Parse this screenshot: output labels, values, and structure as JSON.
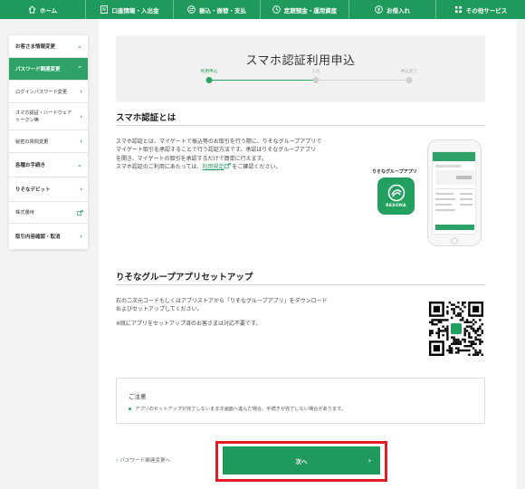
{
  "nav": {
    "items": [
      {
        "icon": "home-icon",
        "label": "ホーム"
      },
      {
        "icon": "bankbook-icon",
        "label": "口座情報・入出金"
      },
      {
        "icon": "transfer-icon",
        "label": "振込・振替・支払"
      },
      {
        "icon": "savings-icon",
        "label": "定期預金・運用資産"
      },
      {
        "icon": "loan-icon",
        "label": "お借入れ"
      },
      {
        "icon": "grid-icon",
        "label": "その他サービス"
      }
    ]
  },
  "sidebar": {
    "items": [
      {
        "label": "お客さま情報変更",
        "chev": "⌄"
      },
      {
        "label": "パスワード関連変更",
        "chev": "⌃"
      },
      {
        "label": "ログインパスワード変更",
        "chev": "›"
      },
      {
        "label": "スマホ認証・ハードウェアトークン等",
        "chev": "›"
      },
      {
        "label": "秘密の質問変更",
        "chev": "›"
      },
      {
        "label": "各種お手続き",
        "chev": "⌄"
      },
      {
        "label": "りそなデビット",
        "chev": "›"
      },
      {
        "label": "株式優待"
      },
      {
        "label": "取引内容確認・取消",
        "chev": "›"
      }
    ]
  },
  "main": {
    "title": "スマホ認証利用申込",
    "steps": [
      {
        "label": "利用申込"
      },
      {
        "label": "入力"
      },
      {
        "label": "申込完了"
      }
    ]
  },
  "section1": {
    "title": "スマホ認証とは",
    "lines": [
      "スマホ認証とは、マイゲートで振込等のお取引を行う際に、りそなグループアプリで",
      "マイゲート取引を承認することで行う認証方法です。承認はりそなグループアプリ",
      "を開き、マイゲートの取引を承認するだけで簡単に行えます。"
    ],
    "line4_pre": "スマホ認証のご利用にあたっては、",
    "line4_link": "利用規定",
    "line4_post": "をご確認ください。",
    "app_label": "りそなグループアプリ",
    "app_icon_text": "RESONA"
  },
  "section2": {
    "title": "りそなグループアプリセットアップ",
    "line1": "右の二次元コードもしくはアプリストアから「りそなグループアプリ」をダウンロード",
    "line2": "およびセットアップしてください。",
    "line3": "※既にアプリをセットアップ済のお客さまは対応不要です。"
  },
  "notice": {
    "title": "ご注意",
    "item": "アプリのセットアップが完了しないまま次画面へ進んだ場合、手続きが完了しない場合があります。"
  },
  "footer": {
    "back_label": "パスワード関連変更へ",
    "next_label": "次へ"
  },
  "colors": {
    "brand": "#1f9a5c",
    "highlight": "#e01e24"
  }
}
